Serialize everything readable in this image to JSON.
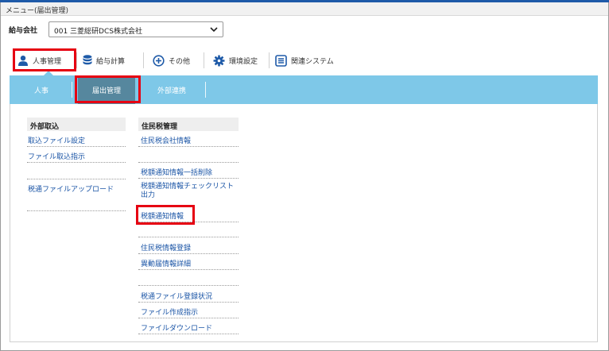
{
  "window": {
    "title": "メニュー(届出管理)"
  },
  "company": {
    "label": "給与会社",
    "selected": "001 三菱総研DCS株式会社"
  },
  "menu": {
    "items": [
      {
        "label": "人事管理",
        "icon": "person-icon"
      },
      {
        "label": "給与計算",
        "icon": "database-icon"
      },
      {
        "label": "その他",
        "icon": "plus-circle-icon"
      },
      {
        "label": "環境設定",
        "icon": "gear-icon"
      },
      {
        "label": "関連システム",
        "icon": "list-icon"
      }
    ]
  },
  "subnav": {
    "tabs": [
      {
        "label": "人事"
      },
      {
        "label": "届出管理"
      },
      {
        "label": "外部連携"
      }
    ]
  },
  "columns": {
    "left": {
      "header": "外部取込",
      "links": [
        "取込ファイル設定",
        "ファイル取込指示",
        "税通ファイルアップロード"
      ]
    },
    "right": {
      "header": "住民税管理",
      "links": [
        "住民税会社情報",
        "税額通知情報一括削除",
        "税額通知情報チェックリスト出力",
        "税額通知情報",
        "住民税情報登録",
        "異動届情報詳細",
        "税通ファイル登録状況",
        "ファイル作成指示",
        "ファイルダウンロード"
      ]
    }
  },
  "colors": {
    "accent_red": "#e60012",
    "subnav_bg": "#7ec8e8",
    "subnav_active": "#56879e",
    "link": "#1b55a6",
    "icon_blue": "#1e5aa8"
  }
}
